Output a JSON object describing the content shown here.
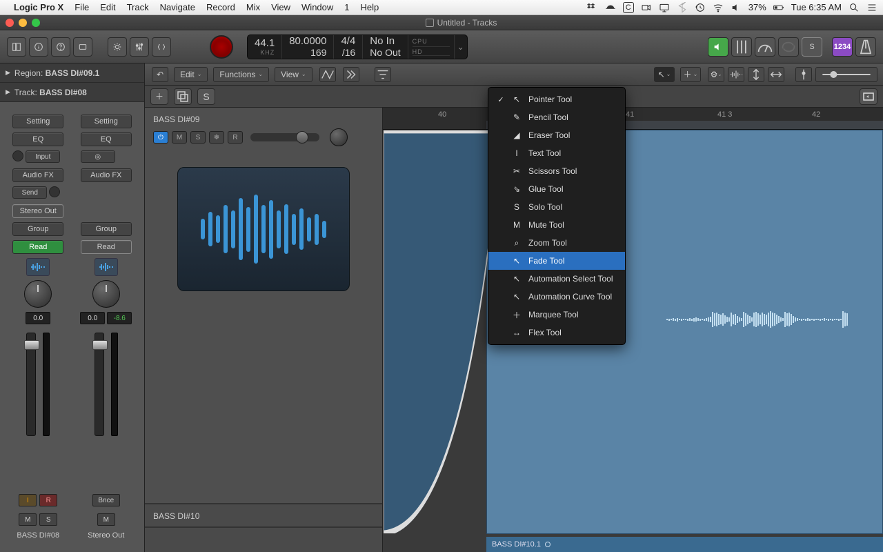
{
  "menubar": {
    "app": "Logic Pro X",
    "items": [
      "File",
      "Edit",
      "Track",
      "Navigate",
      "Record",
      "Mix",
      "View",
      "Window",
      "1",
      "Help"
    ],
    "battery": "37%",
    "clock": "Tue 6:35 AM"
  },
  "window": {
    "title": "Untitled - Tracks"
  },
  "lcd": {
    "sr": "44.1",
    "sr_unit": "KHZ",
    "tempo": "80.0000",
    "bar": "169",
    "sig_top": "4/4",
    "sig_bot": "/16",
    "io_in": "No In",
    "io_out": "No Out",
    "cpu": "CPU",
    "hd": "HD"
  },
  "right_toolbar": {
    "count_label": "1234"
  },
  "inspector": {
    "region_label": "Region:",
    "region_name": "BASS DI#09.1",
    "track_label": "Track:",
    "track_name": "BASS DI#08",
    "strips": [
      {
        "setting": "Setting",
        "eq": "EQ",
        "input": "Input",
        "fx": "Audio FX",
        "send": "Send",
        "out": "Stereo Out",
        "group": "Group",
        "auto": "Read",
        "pan": "0.0",
        "db": "",
        "m": "M",
        "s": "S",
        "i": "I",
        "r": "R",
        "name": "BASS DI#08",
        "auto_green": true
      },
      {
        "setting": "Setting",
        "eq": "EQ",
        "input": "",
        "fx": "Audio FX",
        "send": "",
        "out": "",
        "group": "Group",
        "auto": "Read",
        "pan": "0.0",
        "db": "-8.6",
        "m": "M",
        "bnce": "Bnce",
        "name": "Stereo Out",
        "auto_green": false
      }
    ]
  },
  "workspace": {
    "menus": [
      "Edit",
      "Functions",
      "View"
    ],
    "arrow_tool_open": true,
    "ruler": [
      "40",
      "41",
      "41 3",
      "42"
    ],
    "region_name": "BASS DI#10.1"
  },
  "tool_menu": [
    {
      "label": "Pointer Tool",
      "checked": true,
      "icon": "↖"
    },
    {
      "label": "Pencil Tool",
      "icon": "✎"
    },
    {
      "label": "Eraser Tool",
      "icon": "◢"
    },
    {
      "label": "Text Tool",
      "icon": "I"
    },
    {
      "label": "Scissors Tool",
      "icon": "✂"
    },
    {
      "label": "Glue Tool",
      "icon": "⇘"
    },
    {
      "label": "Solo Tool",
      "icon": "S"
    },
    {
      "label": "Mute Tool",
      "icon": "M"
    },
    {
      "label": "Zoom Tool",
      "icon": "⌕"
    },
    {
      "label": "Fade Tool",
      "icon": "↖",
      "selected": true
    },
    {
      "label": "Automation Select Tool",
      "icon": "↖"
    },
    {
      "label": "Automation Curve Tool",
      "icon": "↖"
    },
    {
      "label": "Marquee Tool",
      "icon": "＋"
    },
    {
      "label": "Flex Tool",
      "icon": "↔"
    }
  ],
  "tracks": [
    {
      "name": "BASS DI#09",
      "power": true,
      "m": "M",
      "s": "S",
      "flex": "❄",
      "r": "R"
    },
    {
      "name": "BASS DI#10"
    }
  ]
}
